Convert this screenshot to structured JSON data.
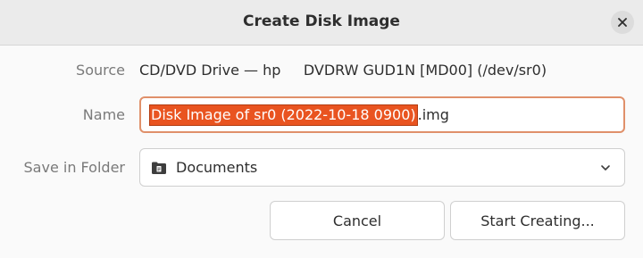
{
  "window": {
    "title": "Create Disk Image"
  },
  "icons": {
    "close": "close-icon",
    "folder": "folder-documents-icon",
    "dropdown": "chevron-down-icon"
  },
  "colors": {
    "accent": "#e95420",
    "focus_border": "#e0906a"
  },
  "form": {
    "source": {
      "label": "Source",
      "value": "CD/DVD Drive — hp     DVDRW GUD1N [MD00] (/dev/sr0)"
    },
    "name": {
      "label": "Name",
      "selected_value": "Disk Image of sr0 (2022-10-18 0900)",
      "extension": ".img"
    },
    "folder": {
      "label": "Save in Folder",
      "value": "Documents"
    }
  },
  "buttons": {
    "cancel": "Cancel",
    "start": "Start Creating..."
  }
}
